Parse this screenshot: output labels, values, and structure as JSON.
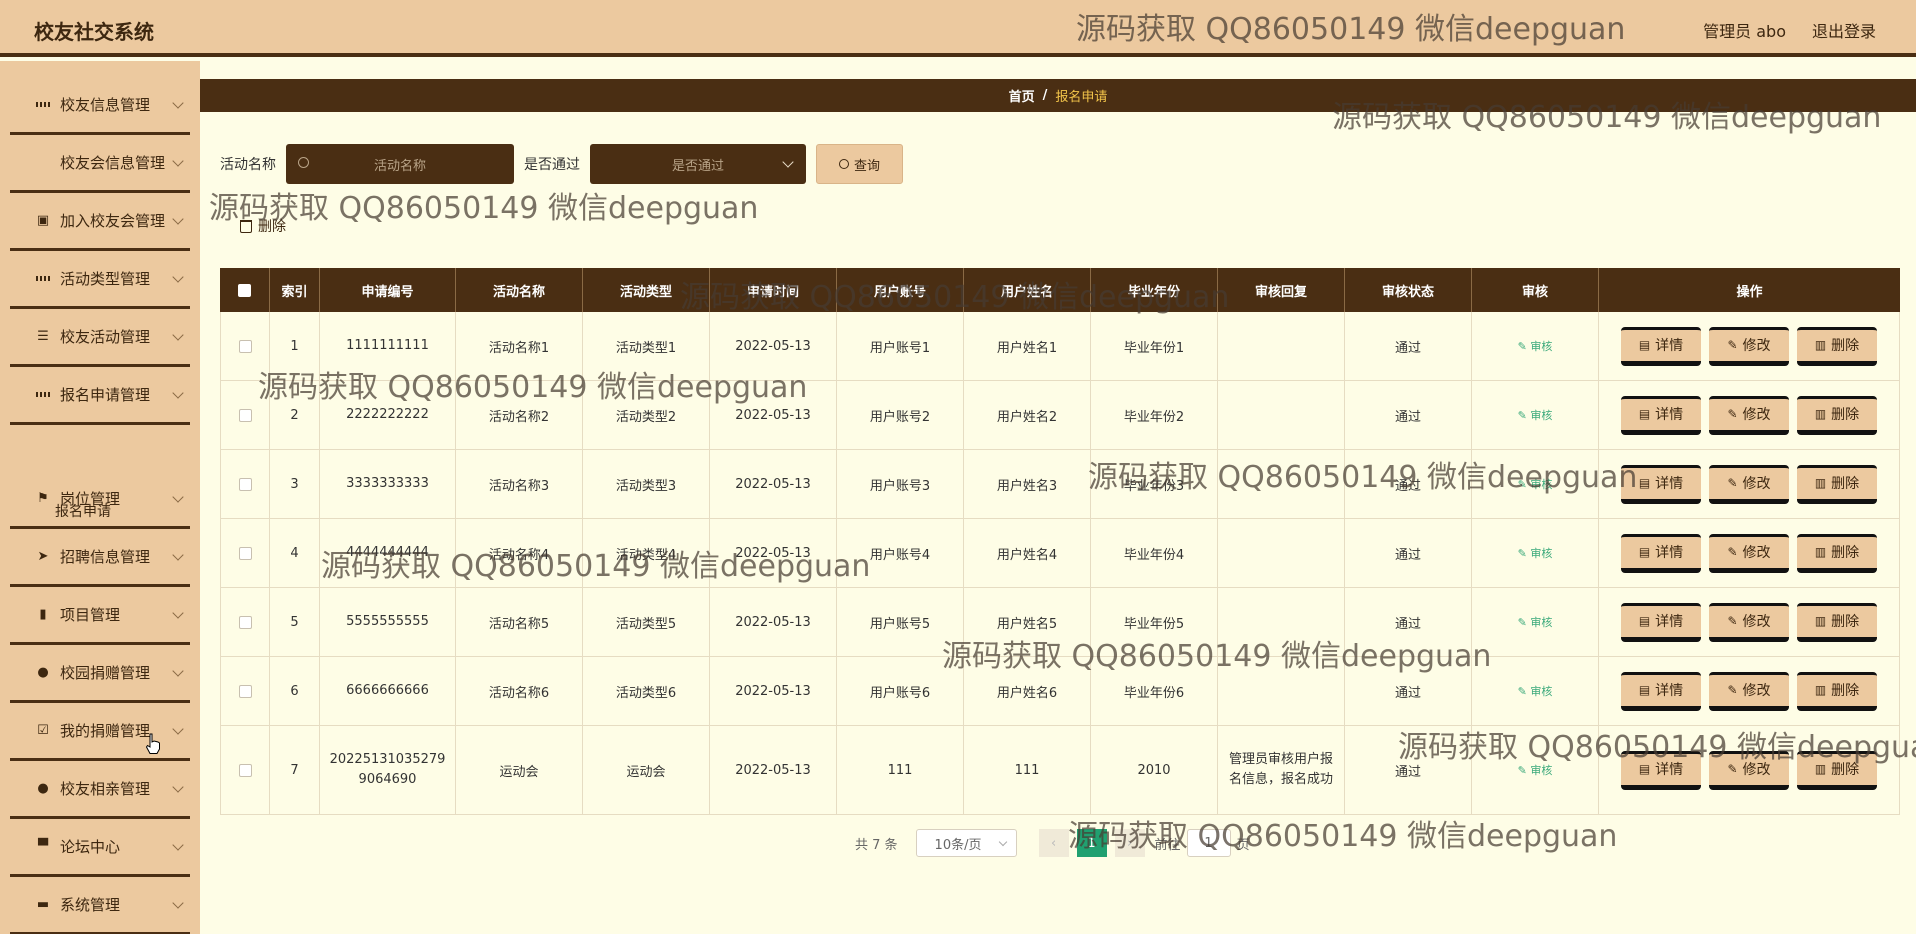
{
  "app": {
    "title": "校友社交系统",
    "user_label": "管理员 abo",
    "logout_label": "退出登录"
  },
  "sidebar": {
    "items": [
      {
        "label": "校友信息管理",
        "icon": "grid-icon"
      },
      {
        "label": "校友会信息管理",
        "icon": "apps-icon"
      },
      {
        "label": "加入校友会管理",
        "icon": "clipboard-icon"
      },
      {
        "label": "活动类型管理",
        "icon": "grid-icon"
      },
      {
        "label": "校友活动管理",
        "icon": "list-icon"
      },
      {
        "label": "报名申请管理",
        "icon": "grid-icon"
      },
      {
        "label": "岗位管理",
        "icon": "flag-icon"
      },
      {
        "label": "招聘信息管理",
        "icon": "send-icon"
      },
      {
        "label": "项目管理",
        "icon": "bar-chart-icon"
      },
      {
        "label": "校园捐赠管理",
        "icon": "user-icon"
      },
      {
        "label": "我的捐赠管理",
        "icon": "clipboard-check-icon"
      },
      {
        "label": "校友相亲管理",
        "icon": "user-icon"
      },
      {
        "label": "论坛中心",
        "icon": "podium-icon"
      },
      {
        "label": "系统管理",
        "icon": "monitor-icon"
      }
    ],
    "sub_item": "报名申请"
  },
  "breadcrumb": {
    "home": "首页",
    "separator": "/",
    "current": "报名申请"
  },
  "search": {
    "activity_label": "活动名称",
    "activity_placeholder": "活动名称",
    "pass_label": "是否通过",
    "pass_placeholder": "是否通过",
    "query_label": "查询"
  },
  "toolbar": {
    "delete_label": "删除"
  },
  "table": {
    "headers": [
      "索引",
      "申请编号",
      "活动名称",
      "活动类型",
      "申请时间",
      "用户账号",
      "用户姓名",
      "毕业年份",
      "审核回复",
      "审核状态",
      "审核",
      "操作"
    ],
    "rows": [
      {
        "index": "1",
        "code": "1111111111",
        "activity": "活动名称1",
        "type": "活动类型1",
        "time": "2022-05-13",
        "account": "用户账号1",
        "name": "用户姓名1",
        "year": "毕业年份1",
        "reply": "",
        "status": "通过"
      },
      {
        "index": "2",
        "code": "2222222222",
        "activity": "活动名称2",
        "type": "活动类型2",
        "time": "2022-05-13",
        "account": "用户账号2",
        "name": "用户姓名2",
        "year": "毕业年份2",
        "reply": "",
        "status": "通过"
      },
      {
        "index": "3",
        "code": "3333333333",
        "activity": "活动名称3",
        "type": "活动类型3",
        "time": "2022-05-13",
        "account": "用户账号3",
        "name": "用户姓名3",
        "year": "毕业年份3",
        "reply": "",
        "status": "通过"
      },
      {
        "index": "4",
        "code": "4444444444",
        "activity": "活动名称4",
        "type": "活动类型4",
        "time": "2022-05-13",
        "account": "用户账号4",
        "name": "用户姓名4",
        "year": "毕业年份4",
        "reply": "",
        "status": "通过"
      },
      {
        "index": "5",
        "code": "5555555555",
        "activity": "活动名称5",
        "type": "活动类型5",
        "time": "2022-05-13",
        "account": "用户账号5",
        "name": "用户姓名5",
        "year": "毕业年份5",
        "reply": "",
        "status": "通过"
      },
      {
        "index": "6",
        "code": "6666666666",
        "activity": "活动名称6",
        "type": "活动类型6",
        "time": "2022-05-13",
        "account": "用户账号6",
        "name": "用户姓名6",
        "year": "毕业年份6",
        "reply": "",
        "status": "通过"
      },
      {
        "index": "7",
        "code": "20225131035279 9064690",
        "activity": "运动会",
        "type": "运动会",
        "time": "2022-05-13",
        "account": "111",
        "name": "111",
        "year": "2010",
        "reply": "管理员审核用户报名信息，报名成功",
        "status": "通过"
      }
    ],
    "audit_label": "审核",
    "detail_label": "详情",
    "edit_label": "修改",
    "remove_label": "删除"
  },
  "pagination": {
    "total": "共 7 条",
    "page_size": "10条/页",
    "current_page": "1",
    "goto_label": "前往",
    "goto_value": "1",
    "page_suffix": "页"
  },
  "watermark": "源码获取 QQ86050149 微信deepguan",
  "colors": {
    "header_bg": "#ecc99f",
    "dark_brown": "#4a2e13",
    "page_bg": "#fefde6",
    "accent_green": "#20a070",
    "crumb_current": "#f2c44a"
  }
}
